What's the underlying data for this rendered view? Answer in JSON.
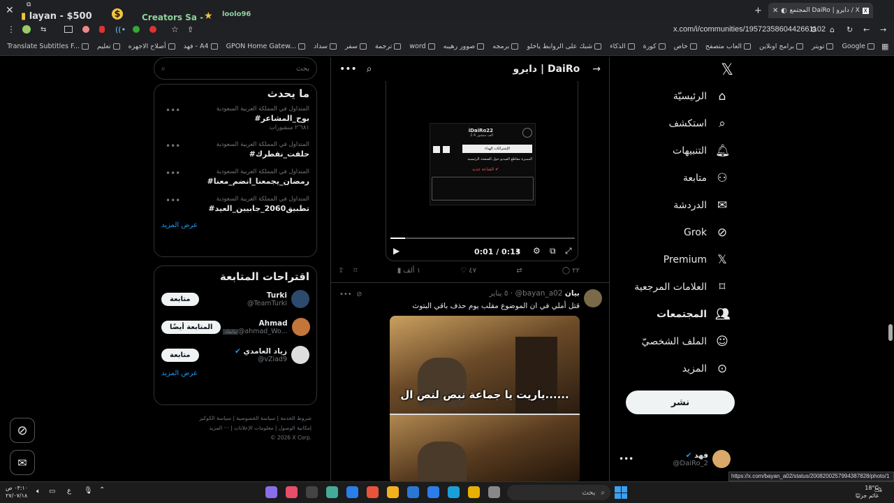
{
  "browser": {
    "tabs": [
      {
        "label": "layan - $500"
      },
      {
        "label": "Creators Sa -"
      },
      {
        "label": "loolo96"
      },
      {
        "label": "المجتمع DaiRo | دايرو / X",
        "active": true
      }
    ],
    "url": "x.com/i/communities/1957235860442661102",
    "bookmarks": [
      "Google",
      "تويتر",
      "برامج اونلاين",
      "العاب متصفح",
      "خاص",
      "كورة",
      "الذكاء",
      "شبك على الروابط ياخلو",
      "برمجه",
      "صوور رهيبه",
      "word",
      "ترجمة",
      "سفر",
      "سداد",
      "GPON Home Gatew...",
      "فهد - A4",
      "أصلاح الاجهزه",
      "تعليم",
      "Translate Subtitles F..."
    ],
    "status_url": "https://x.com/bayan_a02/status/2008200257994387828/photo/1"
  },
  "search": {
    "placeholder": "بحث"
  },
  "trends": {
    "title": "ما يحدث",
    "items": [
      {
        "context": "المتداول في المملكة العربية السعودية",
        "tag": "#بوح_المشاعر",
        "count": "٢٬٦٨١ منشورات"
      },
      {
        "context": "المتداول في المملكة العربية السعودية",
        "tag": "#حلفت_نفطرك",
        "count": ""
      },
      {
        "context": "المتداول في المملكة العربية السعودية",
        "tag": "#رمضان_يجمعنا_انضم_معنا",
        "count": ""
      },
      {
        "context": "المتداول في المملكة العربية السعودية",
        "tag": "#تطبيق2060_جابيين_العيد",
        "count": ""
      }
    ],
    "more": "عرض المزيد"
  },
  "follow": {
    "title": "اقتراحات المتابعة",
    "users": [
      {
        "name": "Turki",
        "handle": "@TeamTurki",
        "button": "متابعة",
        "badge": ""
      },
      {
        "name": "Ahmad",
        "handle": "@ahmad_Wo...",
        "button": "المتابعة أيضًا",
        "badge": "يتابعك"
      },
      {
        "name": "زياد العامدي",
        "handle": "@vZiad9",
        "button": "متابعة",
        "badge": ""
      }
    ],
    "more": "عرض المزيد"
  },
  "footer": {
    "line1": "شروط الخدمة | سياسة الخصوصية | سياسة الكوكيز",
    "line2": "إمكانية الوصول | معلومات الإعلانات | ··· المزيد",
    "line3": "© 2026 X Corp."
  },
  "community": {
    "title": "دايرو | DaiRo"
  },
  "video": {
    "time": "0:01 / 0:13",
    "progress": 0.08,
    "inner": {
      "name": "iDaiRo22",
      "sub": "الف منشور 2.4",
      "button": "الإشتراكات الهداء",
      "tabs": "المميزة  مقاطع الفيديو  حول  الصفحة الرئيسية",
      "text": "الشاعة جديد ✔"
    }
  },
  "post1_actions": {
    "replies": "٢٢",
    "likes": "٤٧",
    "views": "١ ألف"
  },
  "post2": {
    "name": "بيان",
    "handle": "@bayan_a02",
    "time": "٥ يناير",
    "text": "قتل أملي في ان الموضوع مقلب يوم حذف باقي البتوث",
    "meme": "ياريت يا جماعة نبص لنص ال......"
  },
  "nav": {
    "items": [
      {
        "label": "الرئيسيّة",
        "icon": "home-icon"
      },
      {
        "label": "استكشف",
        "icon": "search-icon"
      },
      {
        "label": "التنبيهات",
        "icon": "bell-icon"
      },
      {
        "label": "متابعة",
        "icon": "follow-icon"
      },
      {
        "label": "الدردشة",
        "icon": "mail-icon"
      },
      {
        "label": "Grok",
        "icon": "grok-icon"
      },
      {
        "label": "Premium",
        "icon": "x-logo-icon"
      },
      {
        "label": "العلامات المرجعية",
        "icon": "bookmark-icon"
      },
      {
        "label": "المجتمعات",
        "icon": "communities-icon",
        "bold": true
      },
      {
        "label": "الملف الشخصيّ",
        "icon": "profile-icon"
      },
      {
        "label": "المزيد",
        "icon": "more-icon"
      }
    ],
    "post_button": "نشر"
  },
  "account": {
    "name": "فهد",
    "handle": "@DaiRo_2"
  },
  "taskbar": {
    "search": "بحث",
    "weather": "18°C",
    "weather_desc": "غائم جزئيًا",
    "time": "٠٣:١٠ ص",
    "date": "٢٧/٠٧/١٨",
    "lang": "ع"
  }
}
